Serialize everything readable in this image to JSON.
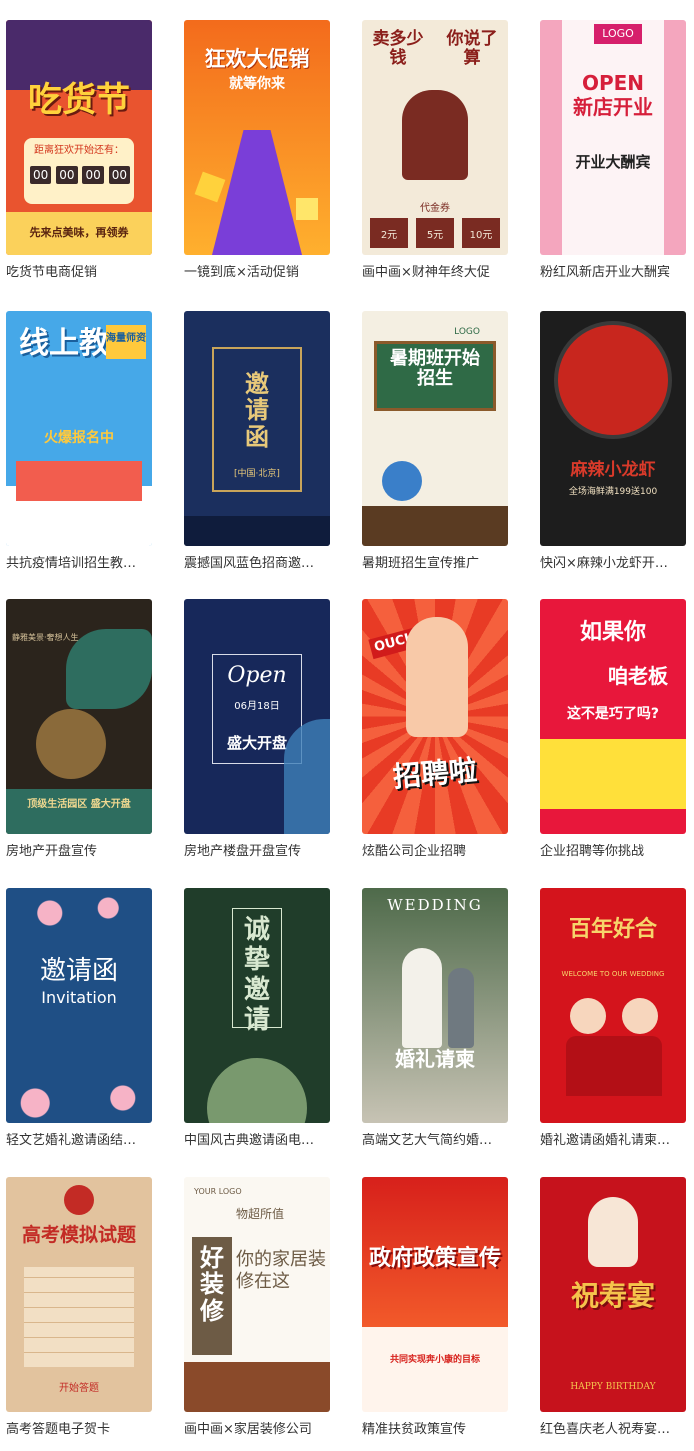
{
  "cards": [
    {
      "title": "吃货节电商促销",
      "overlay_main": "吃货节",
      "overlay_sub": "距离狂欢开始还有：",
      "overlay_extra": "先来点美味，再领券",
      "countdown": [
        "00",
        "00",
        "00",
        "00"
      ],
      "bg": "#e9542f",
      "bg2": "#fbd15b"
    },
    {
      "title": "一镜到底×活动促销",
      "overlay_main": "狂欢大促销",
      "overlay_sub": "就等你来",
      "bg": "#f36b1c",
      "bg2": "#ffd23c"
    },
    {
      "title": "画中画×财神年终大促",
      "overlay_main": "卖多少钱",
      "overlay_sub": "你说了算",
      "overlay_extra": "代金券",
      "coupons": [
        "2元",
        "5元",
        "10元"
      ],
      "bg": "#f3ead9",
      "bg2": "#7a2b22"
    },
    {
      "title": "粉红风新店开业大酬宾",
      "overlay_main": "OPEN",
      "overlay_sub": "新店开业",
      "overlay_extra": "开业大酬宾",
      "logo": "LOGO",
      "bg": "#fdf3f5",
      "bg2": "#e04a74"
    },
    {
      "title": "共抗疫情培训招生教…",
      "overlay_main": "线上教育",
      "overlay_sub": "火爆报名中",
      "overlay_extra": "海量师资",
      "bg": "#46a8e8",
      "bg2": "#ffc93c"
    },
    {
      "title": "震撼国风蓝色招商邀…",
      "overlay_main": "邀请函",
      "overlay_sub": "[中国·北京]",
      "bg": "#1b2f5e",
      "bg2": "#c9a55a"
    },
    {
      "title": "暑期班招生宣传推广",
      "overlay_main": "暑期班开始招生",
      "overlay_sub": "LOGO",
      "bg": "#f4efe2",
      "bg2": "#2f6a46"
    },
    {
      "title": "快闪×麻辣小龙虾开…",
      "overlay_main": "麻辣小龙虾",
      "overlay_sub": "全场海鲜满199送100",
      "bg": "#1d1d1d",
      "bg2": "#c8261e"
    },
    {
      "title": "房地产开盘宣传",
      "overlay_main": "顶级生活园区 盛大开盘",
      "overlay_sub": "静雅美景·奢想人生",
      "bg": "#2b241c",
      "bg2": "#2e6d5f"
    },
    {
      "title": "房地产楼盘开盘宣传",
      "overlay_main": "Open",
      "overlay_sub": "盛大开盘",
      "overlay_extra": "06月18日",
      "bg": "#17285a",
      "bg2": "#3f7fb8"
    },
    {
      "title": "炫酷公司企业招聘",
      "overlay_main": "招聘啦",
      "overlay_sub": "OUCH",
      "bg": "#e83b25",
      "bg2": "#f8d347"
    },
    {
      "title": "企业招聘等你挑战",
      "overlay_main": "如果你",
      "overlay_sub": "咱老板",
      "overlay_extra": "这不是巧了吗?",
      "bg": "#e8173b",
      "bg2": "#ffe03a"
    },
    {
      "title": "轻文艺婚礼邀请函结…",
      "overlay_main": "邀请函",
      "overlay_sub": "Invitation",
      "bg": "#1f4f85",
      "bg2": "#f6b3c6"
    },
    {
      "title": "中国风古典邀请函电…",
      "overlay_main": "诚挚邀请",
      "bg": "#203d2a",
      "bg2": "#9fc18c"
    },
    {
      "title": "高端文艺大气简约婚…",
      "overlay_main": "婚礼请柬",
      "overlay_sub": "WEDDING",
      "bg": "#4e6a4a",
      "bg2": "#c7c3b4"
    },
    {
      "title": "婚礼邀请函婚礼请柬…",
      "overlay_main": "百年好合",
      "overlay_sub": "WELCOME TO OUR WEDDING",
      "bg": "#d4141c",
      "bg2": "#f7d56b"
    },
    {
      "title": "高考答题电子贺卡",
      "overlay_main": "高考模拟试题",
      "overlay_sub": "开始答题",
      "bg": "#e2c39e",
      "bg2": "#c32b25"
    },
    {
      "title": "画中画×家居装修公司",
      "overlay_main": "好装修",
      "overlay_sub": "你的家居装修在这",
      "overlay_extra": "物超所值",
      "logo": "YOUR LOGO",
      "bg": "#fbf8f2",
      "bg2": "#6d5b45"
    },
    {
      "title": "精准扶贫政策宣传",
      "overlay_main": "政府政策宣传",
      "overlay_sub": "共同实现奔小康的目标",
      "bg": "#fff4ec",
      "bg2": "#d7201b"
    },
    {
      "title": "红色喜庆老人祝寿宴…",
      "overlay_main": "祝寿宴",
      "overlay_sub": "HAPPY BIRTHDAY",
      "bg": "#c6121c",
      "bg2": "#f5c34c"
    }
  ]
}
